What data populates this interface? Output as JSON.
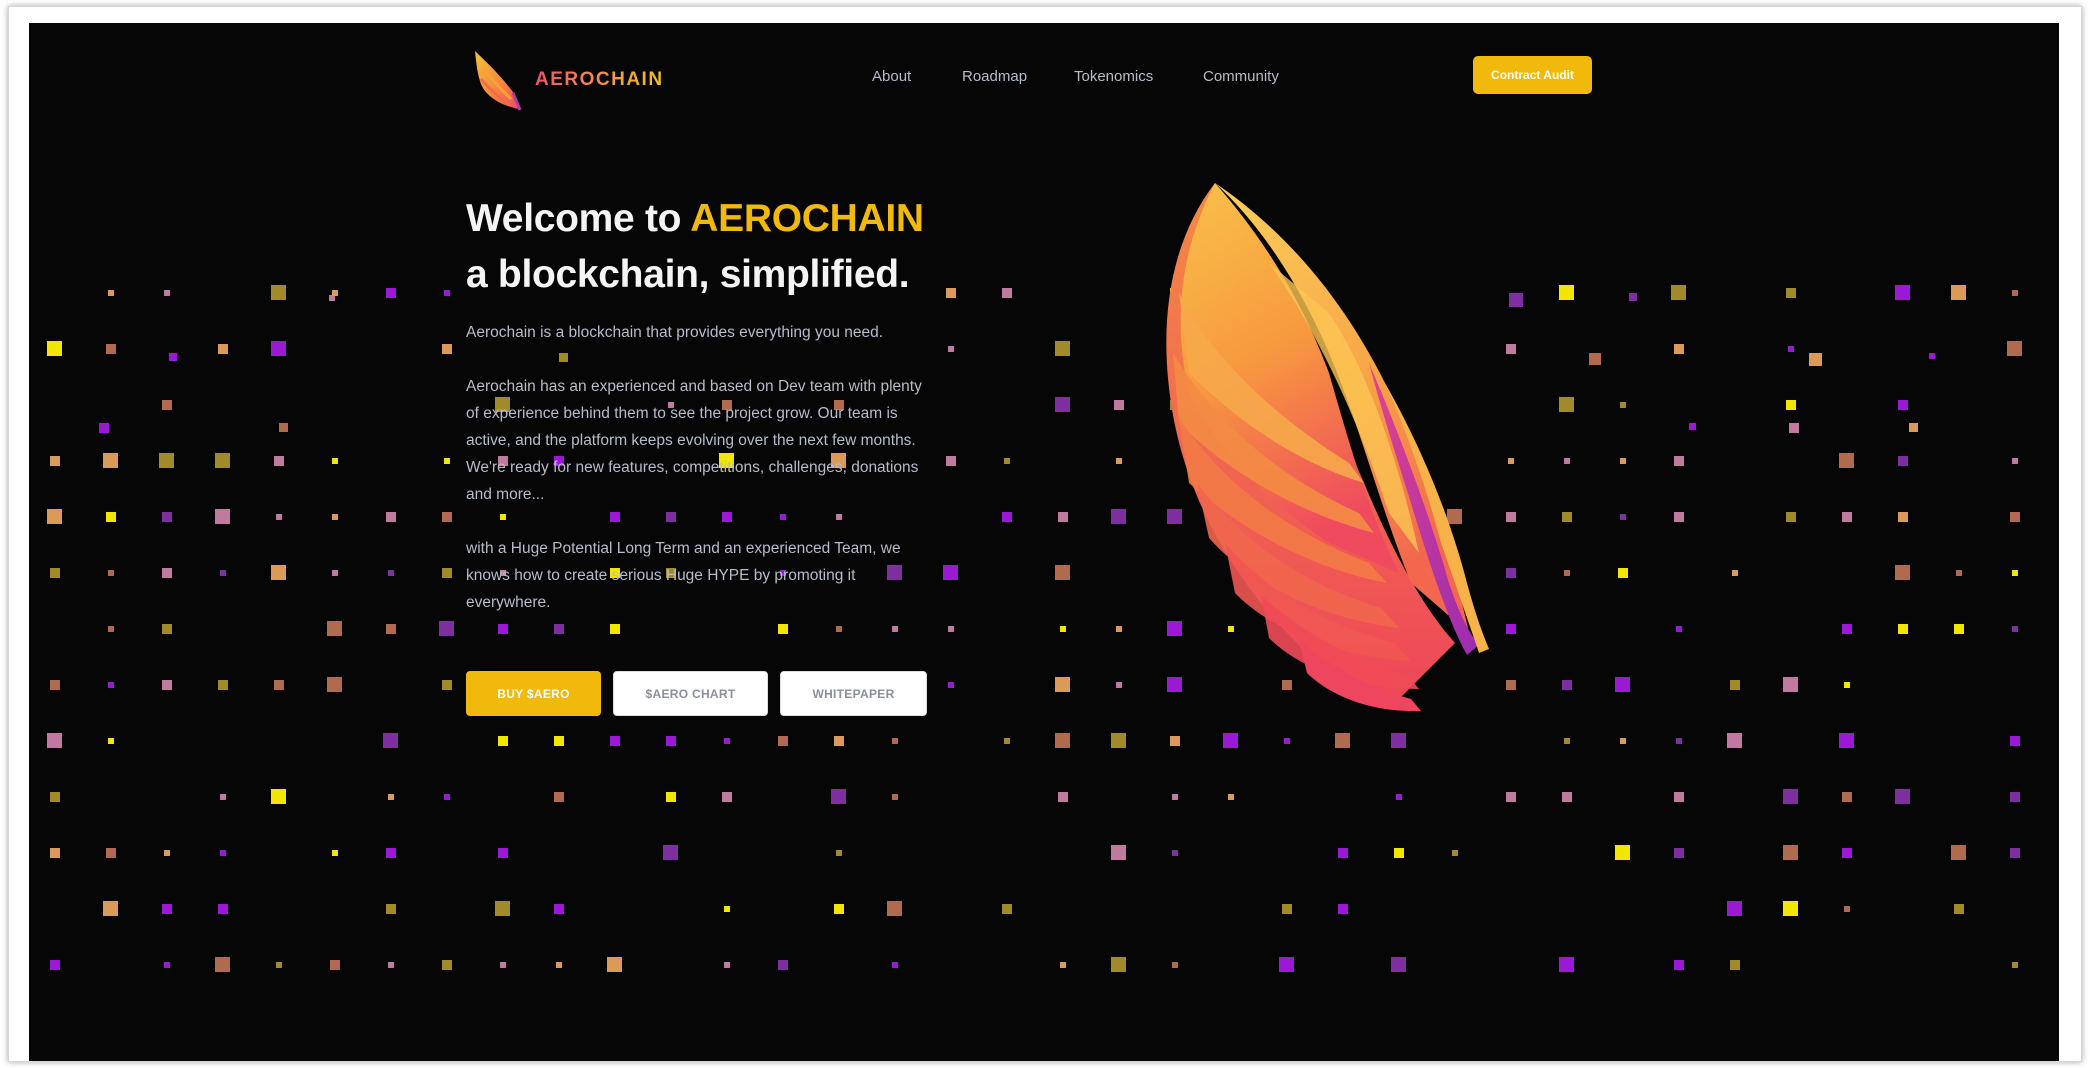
{
  "brand": {
    "name": "AEROCHAIN",
    "gradient": [
      "#f0526b",
      "#f7884a",
      "#f2c21a"
    ]
  },
  "nav": {
    "links": [
      "About",
      "Roadmap",
      "Tokenomics",
      "Community"
    ],
    "cta_label": "Contract Audit"
  },
  "hero": {
    "title_prefix": "Welcome to ",
    "title_accent": "AEROCHAIN",
    "title_line2": "a blockchain, simplified.",
    "paragraph1": "Aerochain is a blockchain that provides everything you need.",
    "paragraph2": "Aerochain has an experienced and based on Dev team with plenty of experience behind them to see the project grow. Our team is active, and the platform keeps evolving over the next few months. We're ready for new features, competitions, challenges, donations and more...",
    "paragraph3": "with a Huge Potential Long Term and an experienced Team, we knows how to create serious Huge HYPE by promoting it everywhere."
  },
  "buttons": {
    "buy": "BUY $AERO",
    "chart": "$AERO CHART",
    "whitepaper": "WHITEPAPER"
  },
  "colors": {
    "background": "#060606",
    "accent": "#f0b90b",
    "text_muted": "#b7bccb",
    "heading": "#f4f4f4",
    "dot_palette": [
      "#f2e500",
      "#9b19d6",
      "#b06b4e",
      "#d99a5a",
      "#7d2fa0",
      "#a08a2a",
      "#c07aa0"
    ]
  },
  "icons": {
    "logo": "wing-logo-icon",
    "hero_art": "wing-illustration"
  }
}
